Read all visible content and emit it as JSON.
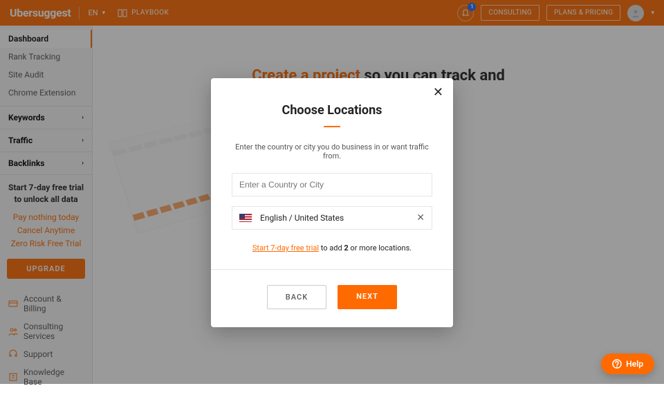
{
  "topbar": {
    "logo": "Ubersuggest",
    "lang": "EN",
    "playbook": "PLAYBOOK",
    "bell_count": "1",
    "consulting": "CONSULTING",
    "plans": "PLANS & PRICING"
  },
  "sidebar": {
    "items": [
      {
        "label": "Dashboard",
        "active": true
      },
      {
        "label": "Rank Tracking"
      },
      {
        "label": "Site Audit"
      },
      {
        "label": "Chrome Extension"
      }
    ],
    "sections": [
      {
        "label": "Keywords"
      },
      {
        "label": "Traffic"
      },
      {
        "label": "Backlinks"
      }
    ],
    "cta": {
      "title_line1": "Start 7-day free trial",
      "title_line2": "to unlock all data",
      "line1": "Pay nothing today",
      "line2": "Cancel Anytime",
      "line3": "Zero Risk Free Trial",
      "button": "UPGRADE"
    },
    "bottom": [
      {
        "label": "Account & Billing",
        "icon": "card"
      },
      {
        "label": "Consulting Services",
        "icon": "people"
      },
      {
        "label": "Support",
        "icon": "headset"
      },
      {
        "label": "Knowledge Base",
        "icon": "book"
      }
    ]
  },
  "hero": {
    "accent": "Create a project",
    "rest": " so you can track and"
  },
  "modal": {
    "title": "Choose Locations",
    "subtitle": "Enter the country or city you do business in or want traffic from.",
    "placeholder": "Enter a Country or City",
    "selected": "English / United States",
    "trial_link": "Start 7-day free trial",
    "trial_mid": " to add ",
    "trial_num": "2",
    "trial_end": " or more locations.",
    "back": "BACK",
    "next": "NEXT"
  },
  "help": {
    "label": "Help"
  }
}
